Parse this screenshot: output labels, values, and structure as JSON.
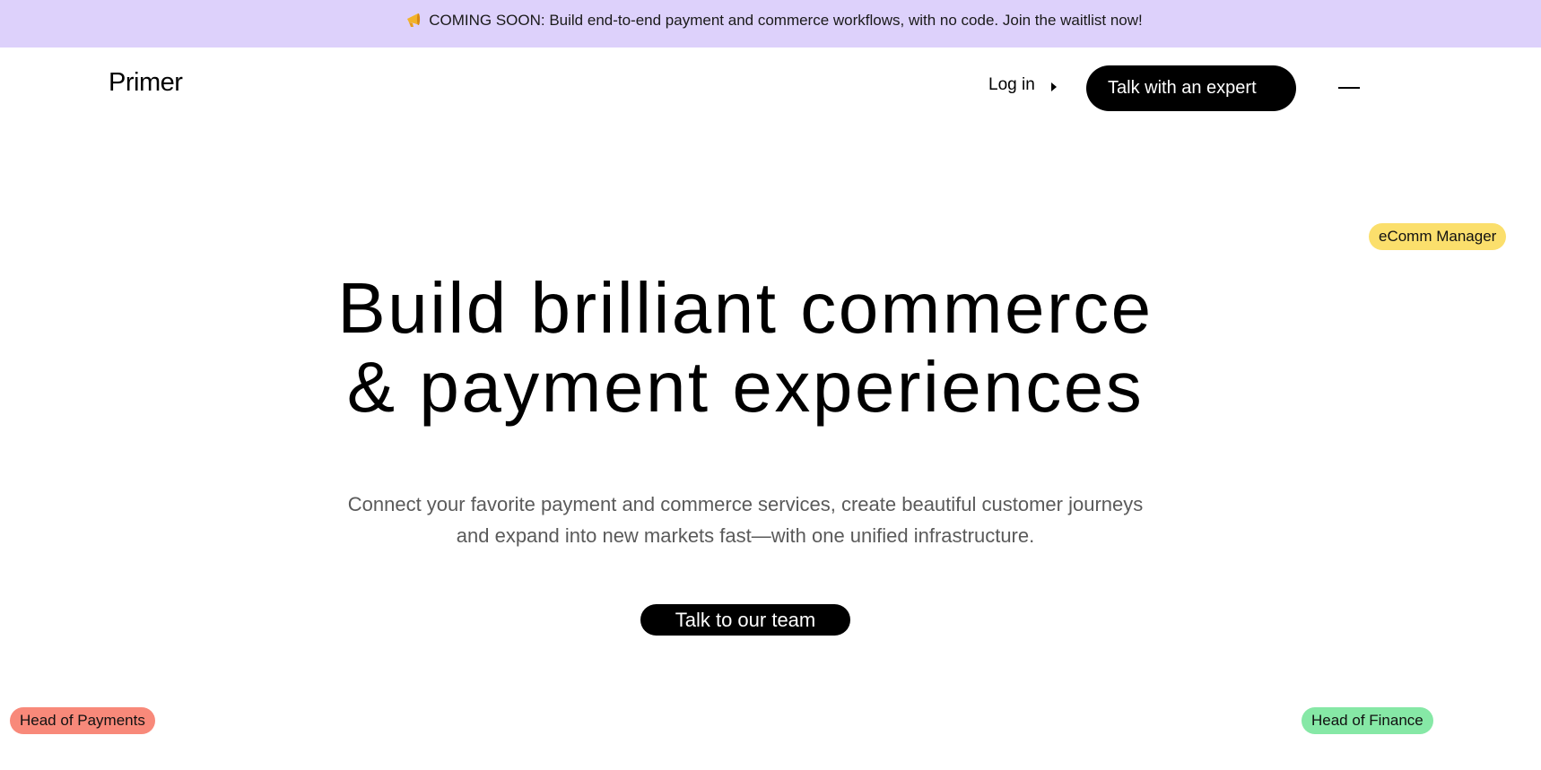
{
  "banner": {
    "icon": "megaphone-icon",
    "text": "COMING SOON: Build end-to-end payment and commerce workflows, with no code. Join the waitlist now!",
    "background": "#ddd1fb"
  },
  "header": {
    "logo_text": "Primer",
    "login_label": "Log in",
    "expert_button_label": "Talk with an expert",
    "menu_icon": "menu-icon"
  },
  "tags": {
    "ecomm_manager": "eComm Manager",
    "head_of_payments": "Head of Payments",
    "head_of_finance": "Head of Finance",
    "colors": {
      "ecomm_manager": "#fbdf6c",
      "head_of_payments": "#f8897a",
      "head_of_finance": "#86e8a6"
    }
  },
  "hero": {
    "title_line1": "Build brilliant commerce",
    "title_line2": "& payment experiences",
    "subtitle_line1": "Connect your favorite payment and commerce services, create beautiful customer journeys",
    "subtitle_line2": "and expand into new markets fast—with one unified infrastructure.",
    "cta_label": "Talk to our team"
  }
}
